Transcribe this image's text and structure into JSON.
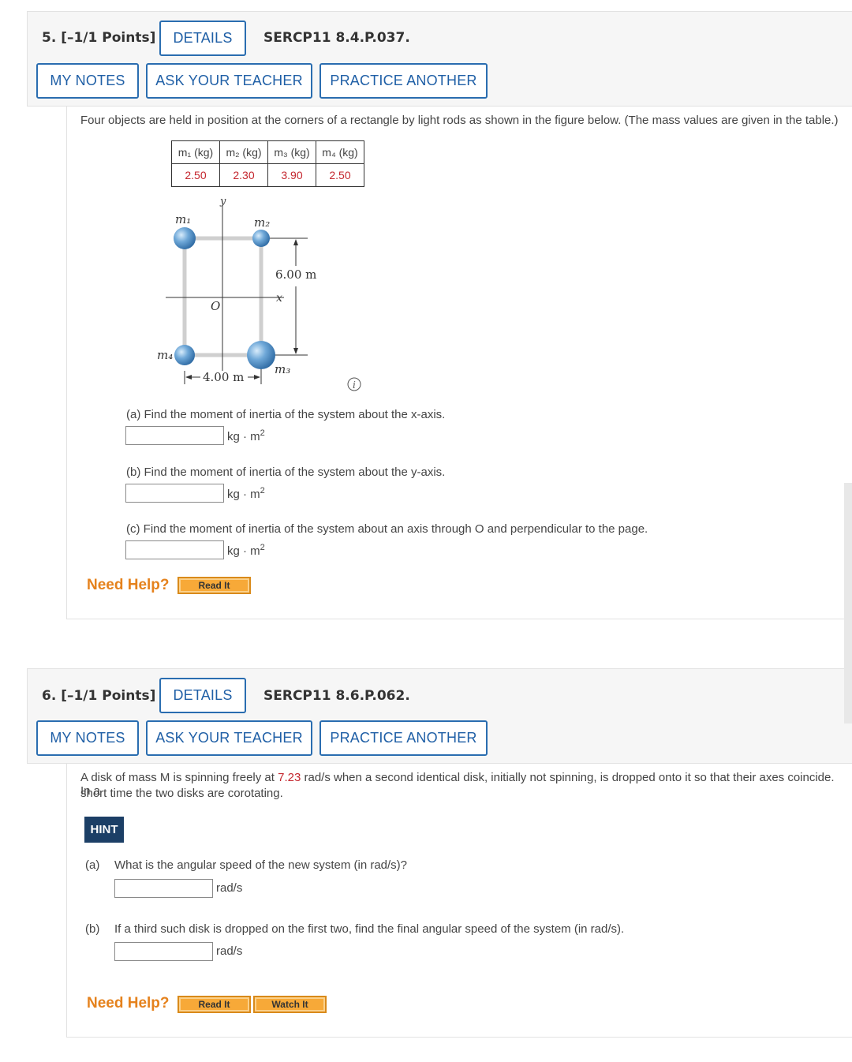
{
  "q5": {
    "number": "5. [–1/1 Points]",
    "details_label": "DETAILS",
    "code": "SERCP11 8.4.P.037.",
    "my_notes": "MY NOTES",
    "ask_teacher": "ASK YOUR TEACHER",
    "practice_another": "PRACTICE ANOTHER",
    "intro": "Four objects are held in position at the corners of a rectangle by light rods as shown in the figure below. (The mass values are given in the table.)",
    "table": {
      "headers": [
        "m₁ (kg)",
        "m₂ (kg)",
        "m₃ (kg)",
        "m₄ (kg)"
      ],
      "values": [
        "2.50",
        "2.30",
        "3.90",
        "2.50"
      ]
    },
    "figure": {
      "label_m1": "m₁",
      "label_m2": "m₂",
      "label_m3": "m₃",
      "label_m4": "m₄",
      "label_y": "y",
      "label_x": "x",
      "label_origin": "O",
      "height_label": "6.00 m",
      "width_label": "4.00 m",
      "info_icon": "info-icon"
    },
    "part_a": "(a) Find the moment of inertia of the system about the x-axis.",
    "part_b": "(b) Find the moment of inertia of the system about the y-axis.",
    "part_c": "(c) Find the moment of inertia of the system about an axis through O and perpendicular to the page.",
    "unit": "kg · m",
    "unit_exp": "2",
    "need_help": "Need Help?",
    "read_it": "Read It"
  },
  "q6": {
    "number": "6. [–1/1 Points]",
    "details_label": "DETAILS",
    "code": "SERCP11 8.6.P.062.",
    "my_notes": "MY NOTES",
    "ask_teacher": "ASK YOUR TEACHER",
    "practice_another": "PRACTICE ANOTHER",
    "intro_1": "A disk of mass M is spinning freely at ",
    "intro_value": "7.23",
    "intro_2": " rad/s when a second identical disk, initially not spinning, is dropped onto it so that their axes coincide. In a",
    "intro_3": "short time the two disks are corotating.",
    "hint": "HINT",
    "part_a_label": "(a)",
    "part_a": "What is the angular speed of the new system (in rad/s)?",
    "part_b_label": "(b)",
    "part_b": "If a third such disk is dropped on the first two, find the final angular speed of the system (in rad/s).",
    "unit": "rad/s",
    "need_help": "Need Help?",
    "read_it": "Read It",
    "watch_it": "Watch It"
  }
}
